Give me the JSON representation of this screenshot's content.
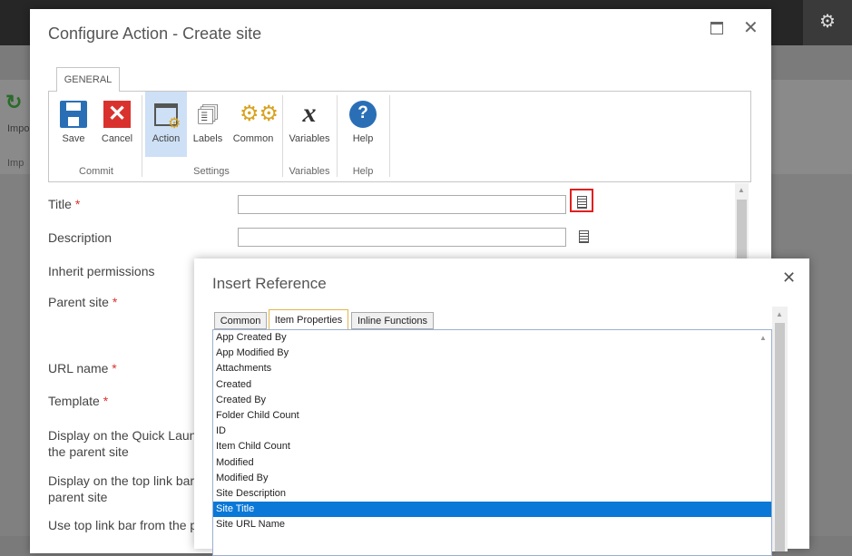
{
  "background": {
    "ribbon_button_label": "Impo",
    "ribbon_group_label": "Imp"
  },
  "dialog": {
    "title": "Configure Action - Create site",
    "tab": "GENERAL",
    "ribbon": {
      "commit": {
        "label": "Commit",
        "save": "Save",
        "cancel": "Cancel"
      },
      "settings": {
        "label": "Settings",
        "action": "Action",
        "labels": "Labels",
        "common": "Common"
      },
      "variables": {
        "label": "Variables",
        "variables": "Variables"
      },
      "help": {
        "label": "Help",
        "help": "Help"
      }
    },
    "form": {
      "title": {
        "label": "Title",
        "required": "*",
        "value": ""
      },
      "description": {
        "label": "Description",
        "value": ""
      },
      "inherit_permissions": {
        "label": "Inherit permissions"
      },
      "parent_site": {
        "label": "Parent site",
        "required": "*"
      },
      "url_name": {
        "label": "URL name",
        "required": "*"
      },
      "template": {
        "label": "Template",
        "required": "*"
      },
      "quick_launch": {
        "label_line1": "Display on the Quick Launch of",
        "label_line2": "the parent site"
      },
      "top_link_bar": {
        "label_line1": "Display on the top link bar of the",
        "label_line2": "parent site"
      },
      "use_top_link_bar": {
        "label": "Use top link bar from the parent site"
      }
    }
  },
  "popup": {
    "title": "Insert Reference",
    "tabs": [
      "Common",
      "Item Properties",
      "Inline Functions"
    ],
    "active_tab": "Item Properties",
    "items": [
      "App Created By",
      "App Modified By",
      "Attachments",
      "Created",
      "Created By",
      "Folder Child Count",
      "ID",
      "Item Child Count",
      "Modified",
      "Modified By",
      "Site Description",
      "Site Title",
      "Site URL Name"
    ],
    "selected_item": "Site Title"
  },
  "colors": {
    "selection": "#0a78d7",
    "ribbon_selected": "#cde0f5",
    "required": "#d9322e",
    "highlight_border": "#e02020",
    "save_icon": "#2a6fb6",
    "cancel_icon": "#d9322e"
  },
  "icons": {
    "settings": "gear-icon",
    "save": "save-icon",
    "cancel": "cancel-icon",
    "action": "action-icon",
    "labels": "labels-icon",
    "common": "common-icon",
    "variables": "variables-icon",
    "help": "help-icon",
    "insert_reference": "insert-reference-icon",
    "maximize": "maximize-icon",
    "close": "close-icon"
  }
}
